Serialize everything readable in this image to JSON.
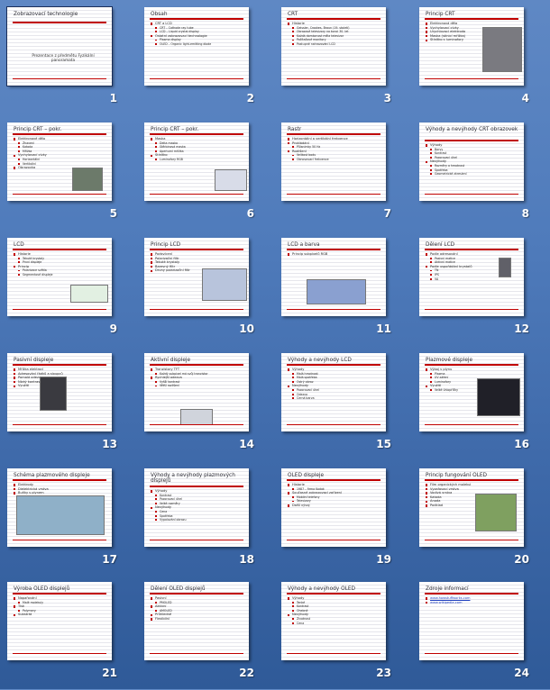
{
  "slides": [
    {
      "num": "1",
      "title": "Zobrazovací technologie",
      "subtitle": "Prezentace z předmětu Fyzikální panoramata",
      "bullets": []
    },
    {
      "num": "2",
      "title": "Obsah",
      "bullets": [
        {
          "lvl": 1,
          "text": "CRT a LCD"
        },
        {
          "lvl": 2,
          "text": "CRT – Cathode ray tube"
        },
        {
          "lvl": 2,
          "text": "LCD – Liquid crystal display"
        },
        {
          "lvl": 1,
          "text": "Ostatní zobrazovací technologie"
        },
        {
          "lvl": 2,
          "text": "Plasma display"
        },
        {
          "lvl": 2,
          "text": "OLED – Organic light-emitting diode"
        }
      ]
    },
    {
      "num": "3",
      "title": "CRT",
      "bullets": [
        {
          "lvl": 1,
          "text": "Historie"
        },
        {
          "lvl": 2,
          "text": "Geissler, Crookes, Braun (19. století)"
        },
        {
          "lvl": 2,
          "text": "Obrazové televizory na konci 30. let"
        },
        {
          "lvl": 2,
          "text": "Každá domácnost měla televizor"
        },
        {
          "lvl": 2,
          "text": "Počítačové monitory"
        },
        {
          "lvl": 2,
          "text": "Postupné nahrazování LCD"
        }
      ]
    },
    {
      "num": "4",
      "title": "Princip CRT",
      "bullets": [
        {
          "lvl": 1,
          "text": "Elektronová děla"
        },
        {
          "lvl": 1,
          "text": "Vychylovací cívky"
        },
        {
          "lvl": 1,
          "text": "Urychlovací elektroda"
        },
        {
          "lvl": 1,
          "text": "Maska (stínicí mřížka)"
        },
        {
          "lvl": 1,
          "text": "Stínítko s luminofory"
        }
      ]
    },
    {
      "num": "5",
      "title": "Princip CRT – pokr.",
      "bullets": [
        {
          "lvl": 1,
          "text": "Elektronové dělo"
        },
        {
          "lvl": 2,
          "text": "Žhavení"
        },
        {
          "lvl": 2,
          "text": "Katoda"
        },
        {
          "lvl": 2,
          "text": "Mřížka"
        },
        {
          "lvl": 1,
          "text": "Vychylovací cívky"
        },
        {
          "lvl": 2,
          "text": "Horizontální"
        },
        {
          "lvl": 2,
          "text": "Vertikální"
        },
        {
          "lvl": 1,
          "text": "Obrazovka"
        }
      ]
    },
    {
      "num": "6",
      "title": "Princip CRT – pokr.",
      "bullets": [
        {
          "lvl": 1,
          "text": "Maska"
        },
        {
          "lvl": 2,
          "text": "Delta maska"
        },
        {
          "lvl": 2,
          "text": "Štěrbinová maska"
        },
        {
          "lvl": 2,
          "text": "Aperturní mřížka"
        },
        {
          "lvl": 1,
          "text": "Stínítko"
        },
        {
          "lvl": 2,
          "text": "Luminofory RGB"
        }
      ]
    },
    {
      "num": "7",
      "title": "Rastr",
      "bullets": [
        {
          "lvl": 1,
          "text": "Horizontální a vertikální frekvence"
        },
        {
          "lvl": 1,
          "text": "Prokládání"
        },
        {
          "lvl": 2,
          "text": "Půlsnímky 50 Hz"
        },
        {
          "lvl": 1,
          "text": "Rozlišení"
        },
        {
          "lvl": 2,
          "text": "Velikost bodu"
        },
        {
          "lvl": 2,
          "text": "Obnovovací frekvence"
        }
      ]
    },
    {
      "num": "8",
      "title": "Výhody a nevýhody CRT obrazovek",
      "bullets": [
        {
          "lvl": 1,
          "text": "Výhody"
        },
        {
          "lvl": 2,
          "text": "Barvy"
        },
        {
          "lvl": 2,
          "text": "Kontrast"
        },
        {
          "lvl": 2,
          "text": "Pozorovací úhel"
        },
        {
          "lvl": 1,
          "text": "Nevýhody"
        },
        {
          "lvl": 2,
          "text": "Rozměry a hmotnost"
        },
        {
          "lvl": 2,
          "text": "Spotřeba"
        },
        {
          "lvl": 2,
          "text": "Geometrické zkreslení"
        }
      ]
    },
    {
      "num": "9",
      "title": "LCD",
      "bullets": [
        {
          "lvl": 1,
          "text": "Historie"
        },
        {
          "lvl": 2,
          "text": "Tekuté krystaly"
        },
        {
          "lvl": 2,
          "text": "První displeje"
        },
        {
          "lvl": 1,
          "text": "Princip"
        },
        {
          "lvl": 2,
          "text": "Polarizace světla"
        },
        {
          "lvl": 2,
          "text": "Segmentové displeje"
        }
      ]
    },
    {
      "num": "10",
      "title": "Princip LCD",
      "bullets": [
        {
          "lvl": 1,
          "text": "Podsvícení"
        },
        {
          "lvl": 1,
          "text": "Polarizační filtr"
        },
        {
          "lvl": 1,
          "text": "Tekuté krystaly"
        },
        {
          "lvl": 1,
          "text": "Barevný filtr"
        },
        {
          "lvl": 1,
          "text": "Druhý polarizační filtr"
        }
      ]
    },
    {
      "num": "11",
      "title": "LCD a barva",
      "bullets": [
        {
          "lvl": 1,
          "text": "Princip subpixelů RGB"
        }
      ]
    },
    {
      "num": "12",
      "title": "Dělení LCD",
      "bullets": [
        {
          "lvl": 1,
          "text": "Podle adresování"
        },
        {
          "lvl": 2,
          "text": "Pasivní matice"
        },
        {
          "lvl": 2,
          "text": "Aktivní matice"
        },
        {
          "lvl": 1,
          "text": "Podle uspořádání krystalů"
        },
        {
          "lvl": 2,
          "text": "TN"
        },
        {
          "lvl": 2,
          "text": "IPS"
        },
        {
          "lvl": 2,
          "text": "VA"
        }
      ]
    },
    {
      "num": "13",
      "title": "Pasivní displeje",
      "bullets": [
        {
          "lvl": 1,
          "text": "Mřížka elektrod"
        },
        {
          "lvl": 1,
          "text": "Adresování řádků a sloupců"
        },
        {
          "lvl": 1,
          "text": "Pomalá odezva"
        },
        {
          "lvl": 1,
          "text": "Nízký kontrast"
        },
        {
          "lvl": 1,
          "text": "Využití"
        }
      ]
    },
    {
      "num": "14",
      "title": "Aktivní displeje",
      "bullets": [
        {
          "lvl": 1,
          "text": "Tranzistory TFT"
        },
        {
          "lvl": 2,
          "text": "Každý subpixel má svůj tranzistor"
        },
        {
          "lvl": 1,
          "text": "Rychlejší odezva"
        },
        {
          "lvl": 2,
          "text": "Vyšší kontrast"
        },
        {
          "lvl": 2,
          "text": "Větší rozlišení"
        }
      ]
    },
    {
      "num": "15",
      "title": "Výhody a nevýhody LCD",
      "bullets": [
        {
          "lvl": 1,
          "text": "Výhody"
        },
        {
          "lvl": 2,
          "text": "Malá hmotnost"
        },
        {
          "lvl": 2,
          "text": "Malá spotřeba"
        },
        {
          "lvl": 2,
          "text": "Ostrý obraz"
        },
        {
          "lvl": 1,
          "text": "Nevýhody"
        },
        {
          "lvl": 2,
          "text": "Pozorovací úhel"
        },
        {
          "lvl": 2,
          "text": "Odezva"
        },
        {
          "lvl": 2,
          "text": "Černá barva"
        }
      ]
    },
    {
      "num": "16",
      "title": "Plazmové displeje",
      "bullets": [
        {
          "lvl": 1,
          "text": "Výboj v plynu"
        },
        {
          "lvl": 2,
          "text": "Plazma"
        },
        {
          "lvl": 2,
          "text": "UV záření"
        },
        {
          "lvl": 2,
          "text": "Luminofory"
        },
        {
          "lvl": 1,
          "text": "Využití"
        },
        {
          "lvl": 2,
          "text": "Velké úhlopříčky"
        }
      ]
    },
    {
      "num": "17",
      "title": "Schéma plazmového displeje",
      "bullets": [
        {
          "lvl": 1,
          "text": "Elektrody"
        },
        {
          "lvl": 1,
          "text": "Dielektrická vrstva"
        },
        {
          "lvl": 1,
          "text": "Buňky s plynem"
        }
      ]
    },
    {
      "num": "18",
      "title": "Výhody a nevýhody plazmových displejů",
      "bullets": [
        {
          "lvl": 1,
          "text": "Výhody"
        },
        {
          "lvl": 2,
          "text": "Kontrast"
        },
        {
          "lvl": 2,
          "text": "Pozorovací úhel"
        },
        {
          "lvl": 2,
          "text": "Velké rozměry"
        },
        {
          "lvl": 1,
          "text": "Nevýhody"
        },
        {
          "lvl": 2,
          "text": "Cena"
        },
        {
          "lvl": 2,
          "text": "Spotřeba"
        },
        {
          "lvl": 2,
          "text": "Vypalování obrazu"
        }
      ]
    },
    {
      "num": "19",
      "title": "OLED displeje",
      "bullets": [
        {
          "lvl": 1,
          "text": "Historie"
        },
        {
          "lvl": 2,
          "text": "1987 – firma Kodak"
        },
        {
          "lvl": 1,
          "text": "Současné zobrazovací zařízení"
        },
        {
          "lvl": 2,
          "text": "Mobilní telefony"
        },
        {
          "lvl": 2,
          "text": "Televizory"
        },
        {
          "lvl": 1,
          "text": "Další vývoj"
        }
      ]
    },
    {
      "num": "20",
      "title": "Princip fungování OLED",
      "bullets": [
        {
          "lvl": 1,
          "text": "Film organických molekul"
        },
        {
          "lvl": 1,
          "text": "Vyzařovací vrstva"
        },
        {
          "lvl": 1,
          "text": "Vodivá vrstva"
        },
        {
          "lvl": 1,
          "text": "Katoda"
        },
        {
          "lvl": 1,
          "text": "Anoda"
        },
        {
          "lvl": 1,
          "text": "Podklad"
        }
      ]
    },
    {
      "num": "21",
      "title": "Výroba OLED displejů",
      "bullets": [
        {
          "lvl": 1,
          "text": "Napařování"
        },
        {
          "lvl": 2,
          "text": "Malé molekuly"
        },
        {
          "lvl": 1,
          "text": "Tisk"
        },
        {
          "lvl": 2,
          "text": "Polymery"
        },
        {
          "lvl": 1,
          "text": "Substrát"
        }
      ]
    },
    {
      "num": "22",
      "title": "Dělení OLED displejů",
      "bullets": [
        {
          "lvl": 1,
          "text": "Pasivní"
        },
        {
          "lvl": 2,
          "text": "PMOLED"
        },
        {
          "lvl": 1,
          "text": "Aktivní"
        },
        {
          "lvl": 2,
          "text": "AMOLED"
        },
        {
          "lvl": 1,
          "text": "Průhledné"
        },
        {
          "lvl": 1,
          "text": "Flexibilní"
        }
      ]
    },
    {
      "num": "23",
      "title": "Výhody a nevýhody OLED",
      "bullets": [
        {
          "lvl": 1,
          "text": "Výhody"
        },
        {
          "lvl": 2,
          "text": "Tenké"
        },
        {
          "lvl": 2,
          "text": "Kontrast"
        },
        {
          "lvl": 2,
          "text": "Ohebné"
        },
        {
          "lvl": 1,
          "text": "Nevýhody"
        },
        {
          "lvl": 2,
          "text": "Životnost"
        },
        {
          "lvl": 2,
          "text": "Cena"
        }
      ]
    },
    {
      "num": "24",
      "title": "Zdroje informací",
      "links": [
        "www.howstuffworks.com",
        "www.wikipedia.com"
      ],
      "bullets": []
    }
  ]
}
